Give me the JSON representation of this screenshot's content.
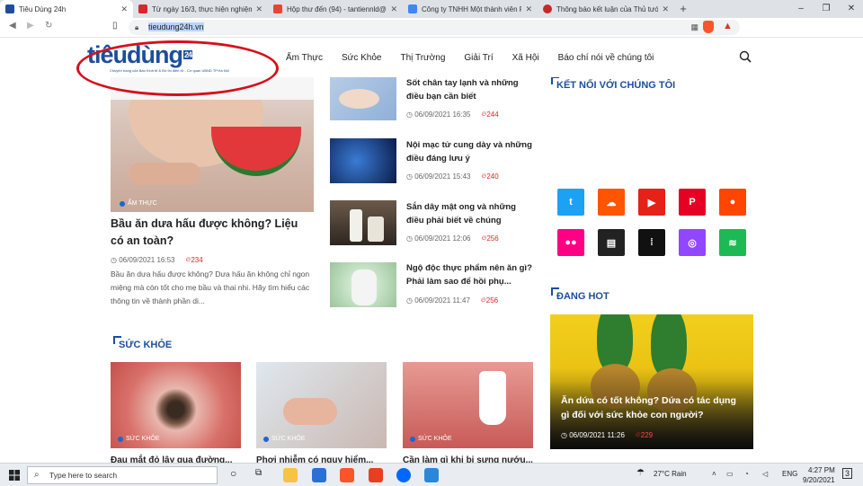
{
  "browser": {
    "tabs": [
      {
        "label": "Tiêu Dùng 24h",
        "active": true,
        "color": "#1c4e9c"
      },
      {
        "label": "Từ ngày 16/3, thực hiện nghiệm việc ở...",
        "active": false,
        "color": "#d7262c"
      },
      {
        "label": "Hộp thư đến (94) - tantiennld@gmail...",
        "active": false,
        "color": "#ea4335"
      },
      {
        "label": "Công ty TNHH Một thành viên Phân m...",
        "active": false,
        "color": "#4285f4"
      },
      {
        "label": "Thông báo kết luận của Thủ tướng Ch...",
        "active": false,
        "color": "#c62828"
      }
    ],
    "new_tab": "+",
    "window_min": "–",
    "window_max": "❐",
    "window_close": "✕",
    "url": "tieudung24h.vn"
  },
  "site": {
    "logo_text": "tiêudùng",
    "logo_suffix": "24",
    "logo_tagline": "Chuyên trang của Báo Kinh tế & Đô thị điện tử - Cơ quan UBND TP.Hà Nội",
    "menu": [
      "Ẩm Thực",
      "Sức Khỏe",
      "Thị Trường",
      "Giải Trí",
      "Xã Hội",
      "Báo chí nói về chúng tôi"
    ],
    "featured": {
      "category": "ẨM THỰC",
      "title": "Bầu ăn dưa hấu được không? Liệu có an toàn?",
      "date": "06/09/2021 16:53",
      "views": "234",
      "excerpt": "Bầu ăn dưa hấu được không? Dưa hấu ăn không chỉ ngon miệng mà còn tốt cho mẹ bầu và thai nhi. Hãy tìm hiểu các thông tin về thành phần di..."
    },
    "side_articles": [
      {
        "title": "Sốt chân tay lạnh và những điều bạn cần biết",
        "date": "06/09/2021 16:35",
        "views": "244"
      },
      {
        "title": "Nội mạc tử cung dày và những điều đáng lưu ý",
        "date": "06/09/2021 15:43",
        "views": "240"
      },
      {
        "title": "Sắn dây mật ong và những điều phải biết về chúng",
        "date": "06/09/2021 12:06",
        "views": "256"
      },
      {
        "title": "Ngộ độc thực phẩm nên ăn gì? Phải làm sao để hồi phụ...",
        "date": "06/09/2021 11:47",
        "views": "256"
      }
    ],
    "connect_title": "KẾT NỐI VỚI CHÚNG TÔI",
    "social": [
      {
        "name": "twitter",
        "glyph": "t",
        "color": "#1da1f2"
      },
      {
        "name": "soundcloud",
        "glyph": "☁",
        "color": "#ff5500"
      },
      {
        "name": "youtube",
        "glyph": "▶",
        "color": "#e62117"
      },
      {
        "name": "pinterest",
        "glyph": "P",
        "color": "#e60023"
      },
      {
        "name": "reddit",
        "glyph": "●",
        "color": "#ff4500"
      },
      {
        "name": "flickr",
        "glyph": "●●",
        "color": "#ff0084"
      },
      {
        "name": "news",
        "glyph": "▤",
        "color": "#222222"
      },
      {
        "name": "deezer",
        "glyph": "⁞",
        "color": "#111111"
      },
      {
        "name": "podcast",
        "glyph": "◎",
        "color": "#9146ff"
      },
      {
        "name": "spotify",
        "glyph": "≋",
        "color": "#1db954"
      }
    ],
    "hot_title": "ĐANG HOT",
    "hot_article": {
      "title": "Ăn dứa có tốt không? Dứa có tác dụng gì đối với sức khỏe con người?",
      "date": "06/09/2021 11:26",
      "views": "229"
    },
    "health_title": "SỨC KHỎE",
    "health_cards": [
      {
        "category": "SỨC KHỎE",
        "title": "Đau mắt đỏ lây qua đường..."
      },
      {
        "category": "SỨC KHỎE",
        "title": "Phơi nhiễm có nguy hiểm..."
      },
      {
        "category": "SỨC KHỎE",
        "title": "Cần làm gì khi bị sưng nướu..."
      }
    ]
  },
  "taskbar": {
    "search_placeholder": "Type here to search",
    "weather": "27°C  Rain",
    "language": "ENG",
    "time": "4:27 PM",
    "date": "9/20/2021",
    "notifications": "3"
  }
}
